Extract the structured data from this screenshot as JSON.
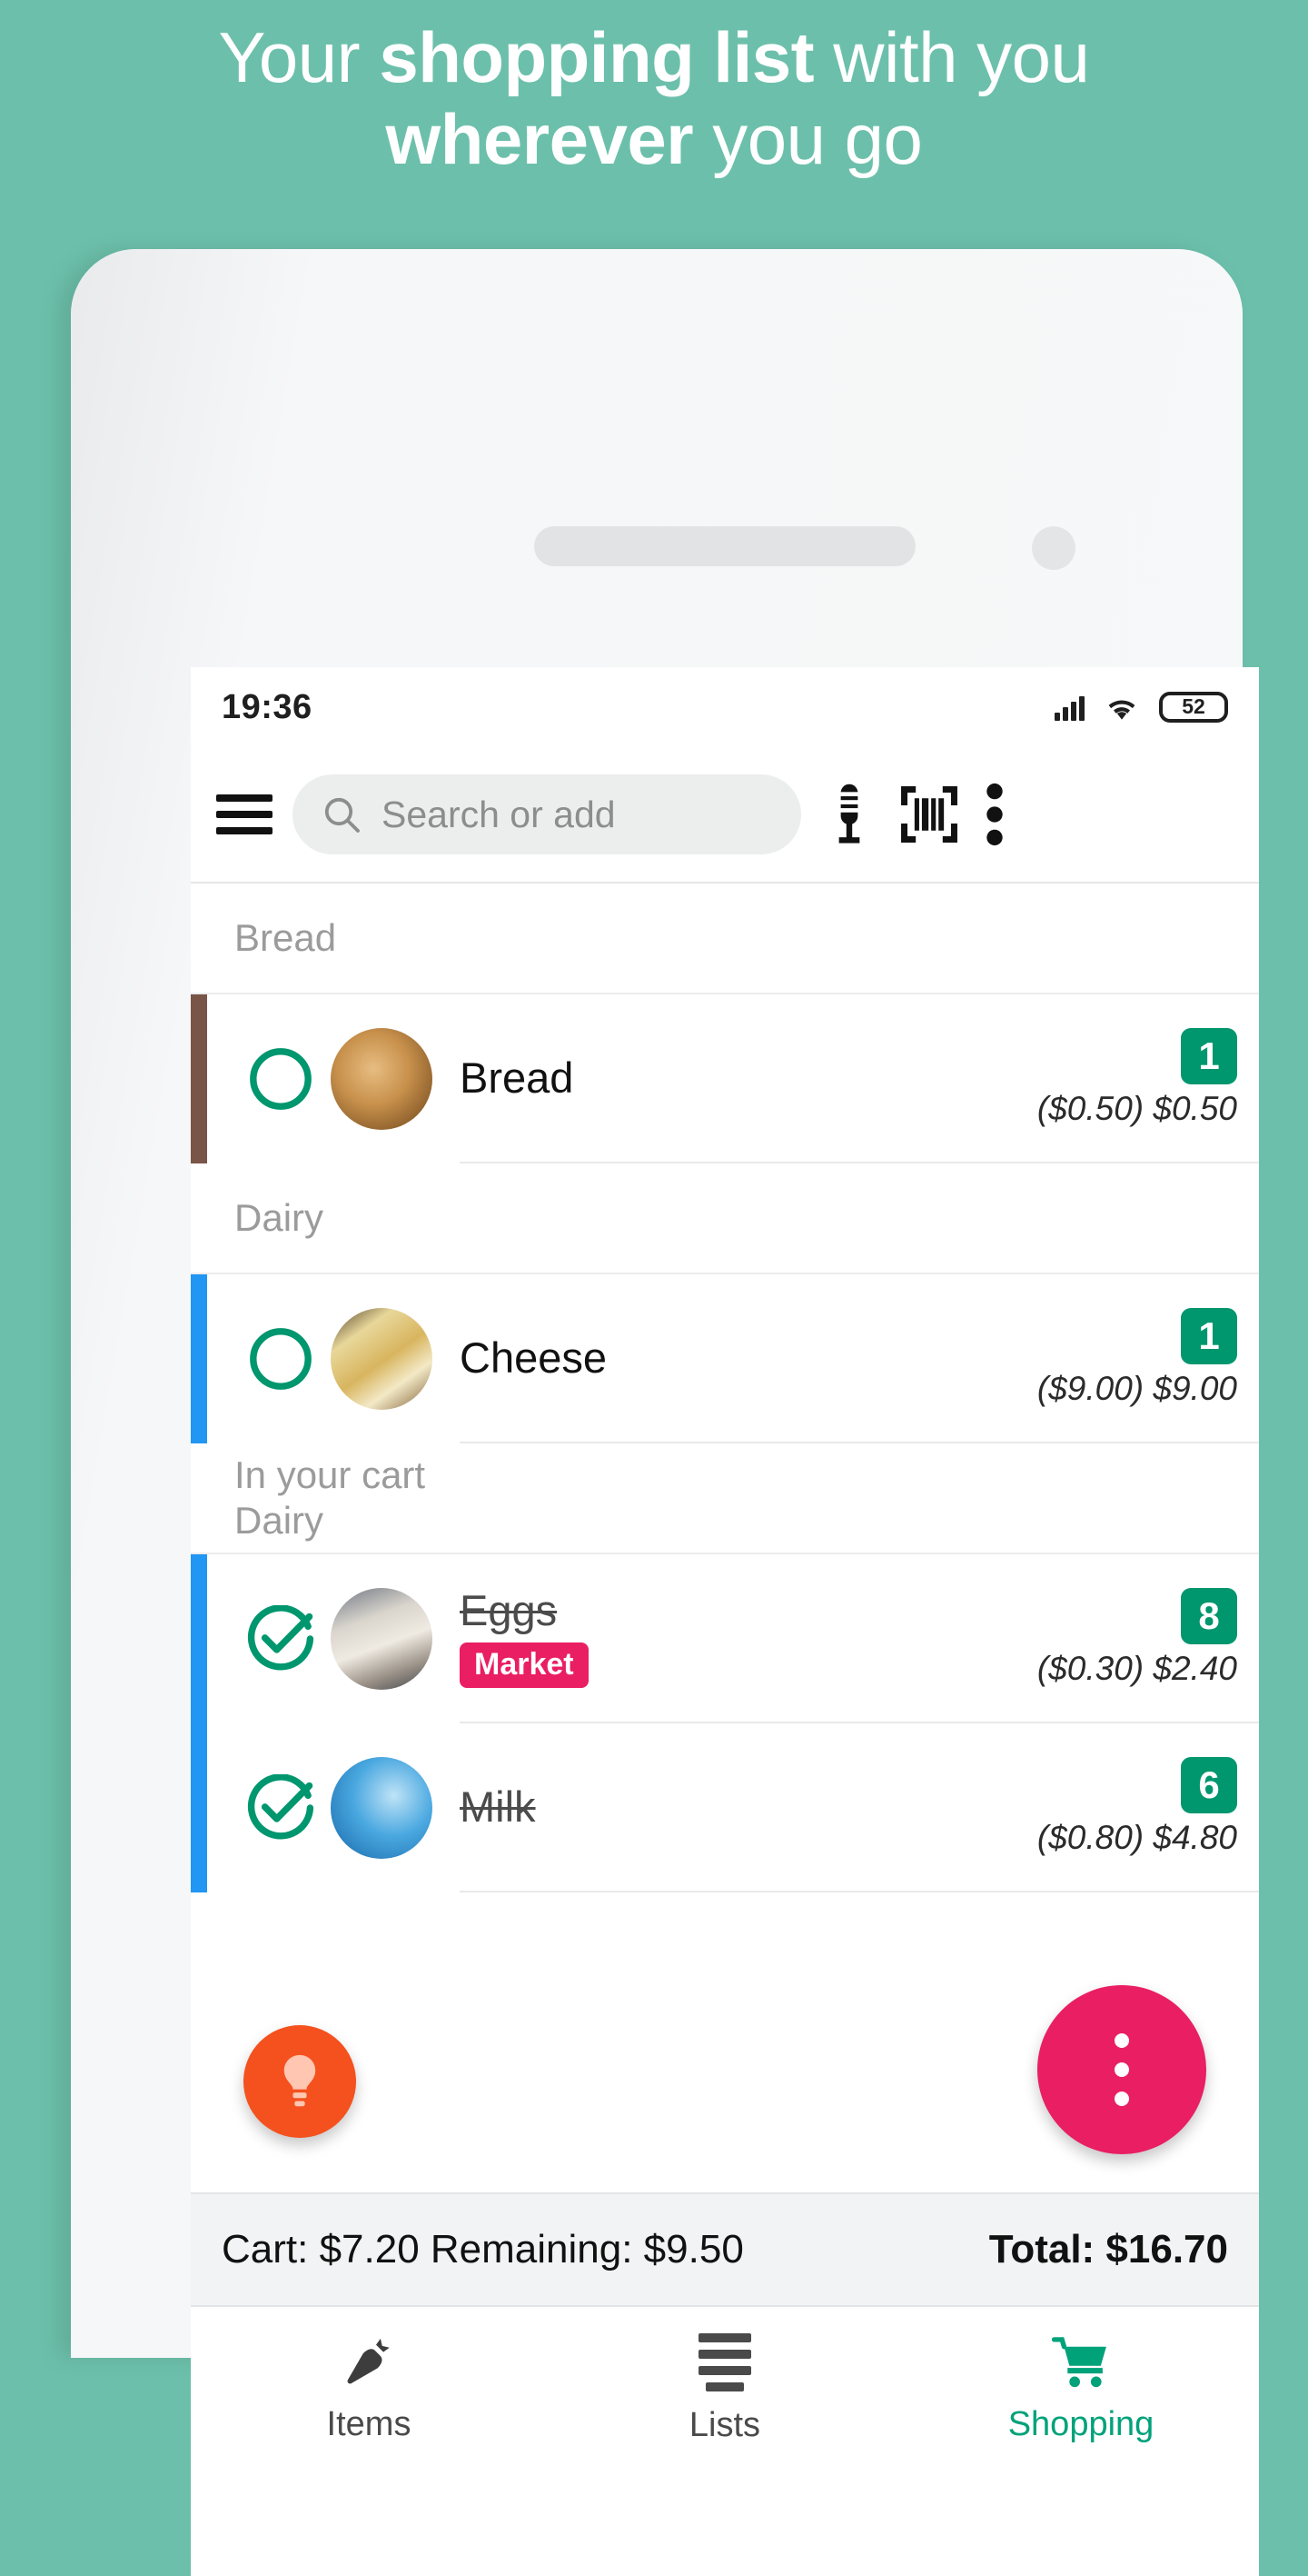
{
  "promo": {
    "line1_pre": "Your ",
    "line1_bold": "shopping list",
    "line1_post": " with you",
    "line2_bold": "wherever",
    "line2_post": " you go",
    "background_color": "#6cc0ab"
  },
  "status_bar": {
    "time": "19:36",
    "battery_level": "52",
    "signal_icon": "signal-bars-icon",
    "wifi_icon": "wifi-icon",
    "battery_icon": "battery-icon"
  },
  "toolbar": {
    "menu_icon": "hamburger-menu-icon",
    "search_placeholder": "Search or add",
    "search_value": "",
    "search_icon": "search-icon",
    "mic_icon": "microphone-icon",
    "barcode_icon": "barcode-scanner-icon",
    "overflow_icon": "overflow-menu-icon"
  },
  "list": {
    "groups": [
      {
        "header": "Bread",
        "subheader": "",
        "accent_color": "#795548",
        "items": [
          {
            "name": "Bread",
            "checked": false,
            "store": "",
            "qty": "1",
            "price": "($0.50) $0.50",
            "thumb": "bread-photo"
          }
        ]
      },
      {
        "header": "Dairy",
        "subheader": "",
        "accent_color": "#2196f3",
        "items": [
          {
            "name": "Cheese",
            "checked": false,
            "store": "",
            "qty": "1",
            "price": "($9.00) $9.00",
            "thumb": "cheese-photo"
          }
        ]
      },
      {
        "header": "In your cart",
        "subheader": "Dairy",
        "accent_color": "#2196f3",
        "items": [
          {
            "name": "Eggs",
            "checked": true,
            "store": "Market",
            "qty": "8",
            "price": "($0.30) $2.40",
            "thumb": "eggs-photo"
          },
          {
            "name": "Milk",
            "checked": true,
            "store": "",
            "qty": "6",
            "price": "($0.80) $4.80",
            "thumb": "milk-photo"
          }
        ]
      }
    ]
  },
  "fabs": {
    "tip_icon": "lightbulb-icon",
    "tip_color": "#f4511e",
    "more_icon": "overflow-menu-icon",
    "more_color": "#e91e63"
  },
  "summary": {
    "left": "Cart: $7.20 Remaining: $9.50",
    "right": "Total: $16.70"
  },
  "bottom_nav": {
    "items": [
      {
        "label": "Items",
        "icon": "carrot-icon",
        "active": false
      },
      {
        "label": "Lists",
        "icon": "list-icon",
        "active": false
      },
      {
        "label": "Shopping",
        "icon": "shopping-cart-icon",
        "active": true
      }
    ],
    "active_color": "#00a27a"
  },
  "colors": {
    "accent_green": "#00966e",
    "accent_pink": "#e91e63",
    "accent_orange": "#f4511e",
    "brand_teal": "#6cc0ab"
  }
}
